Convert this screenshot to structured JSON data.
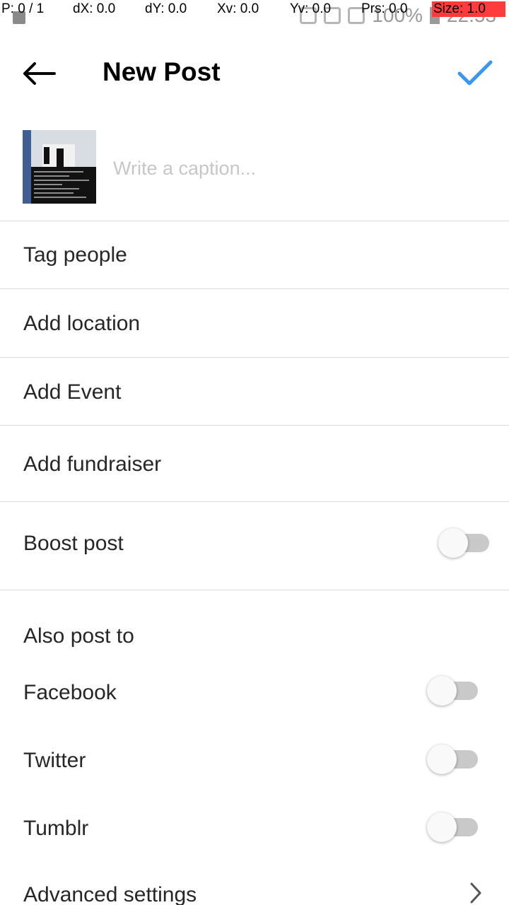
{
  "debug_overlay": {
    "p": "P: 0 / 1",
    "dx": "dX: 0.0",
    "dy": "dY: 0.0",
    "xv": "Xv: 0.0",
    "yv": "Yv: 0.0",
    "prs": "Prs: 0.0",
    "size": "Size: 1.0"
  },
  "status_bar": {
    "battery": "100%",
    "time": "22:53"
  },
  "header": {
    "title": "New Post",
    "back_icon": "arrow-left-icon",
    "confirm_icon": "checkmark-icon",
    "accent_color": "#3897f0"
  },
  "caption": {
    "placeholder": "Write a caption...",
    "value": ""
  },
  "menu": {
    "tag_people": "Tag people",
    "add_location": "Add location",
    "add_event": "Add Event",
    "add_fundraiser": "Add fundraiser"
  },
  "boost": {
    "label": "Boost post",
    "enabled": false
  },
  "also_post_to": {
    "heading": "Also post to",
    "facebook": "Facebook",
    "twitter": "Twitter",
    "tumblr": "Tumblr"
  },
  "advanced": {
    "label": "Advanced settings",
    "icon": "chevron-right-icon"
  }
}
